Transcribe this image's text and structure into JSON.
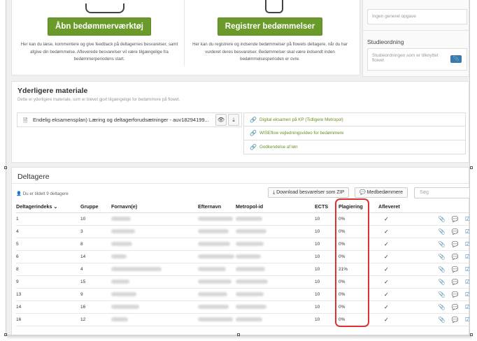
{
  "tools": {
    "left": {
      "button": "Åbn bedømmerværktøj",
      "description": "Her kan du læse, kommentere og give feedback på deltagernes besvarelser, samt afgive din bedømmelse. Afleverede besvarelser vil være tilgængelige fra bedømmerperiodens start."
    },
    "right": {
      "button": "Registrer bedømmelser",
      "description": "Her kan du registrere og indsende bedømmelser på flowets deltagere, når du har vurderet deres besvarelser. Bedømmelser skal være indsendt inden bedømmelsesperioden er ovre."
    }
  },
  "sidebar": {
    "general_task_placeholder": "Ingen generel opgave",
    "study_title": "Studieordning",
    "study_placeholder": "Studieordningen som er tilknyttet flowet"
  },
  "material": {
    "title": "Yderligere materiale",
    "subtitle": "Dette er yderligere materiale, som er blevet gjort tilgængelige for bedømmere på flowet.",
    "file": "Endelig eksamensplan) Læring og deltagerforudsætninger - auv18294199...",
    "links": [
      "Digital eksamen på KP (Tidligere Metropol)",
      "WISEflow vejledningsvideo for bedømmere",
      "Godkendelse af løn"
    ]
  },
  "participants": {
    "title": "Deltagere",
    "assigned": "Du er tildelt 9 deltagere",
    "download_label": "Download besvarelser som ZIP",
    "coassessors_label": "Medbedømmere",
    "search_placeholder": "Søg",
    "columns": [
      "Deltagerindeks",
      "Gruppe",
      "Fornavn(e)",
      "Efternavn",
      "Metropol-id",
      "ECTS",
      "Plagiering",
      "Afleveret"
    ],
    "rows": [
      {
        "index": "1",
        "group": "10",
        "ects": "10",
        "plag": "0%",
        "delivered": "✓"
      },
      {
        "index": "4",
        "group": "3",
        "ects": "10",
        "plag": "0%",
        "delivered": "✓"
      },
      {
        "index": "5",
        "group": "8",
        "ects": "10",
        "plag": "0%",
        "delivered": "✓"
      },
      {
        "index": "6",
        "group": "14",
        "ects": "10",
        "plag": "0%",
        "delivered": "✓"
      },
      {
        "index": "8",
        "group": "4",
        "ects": "10",
        "plag": "21%",
        "delivered": "✓"
      },
      {
        "index": "9",
        "group": "15",
        "ects": "10",
        "plag": "0%",
        "delivered": "✓"
      },
      {
        "index": "13",
        "group": "9",
        "ects": "10",
        "plag": "0%",
        "delivered": "✓"
      },
      {
        "index": "14",
        "group": "16",
        "ects": "10",
        "plag": "0%",
        "delivered": "✓"
      },
      {
        "index": "16",
        "group": "12",
        "ects": "10",
        "plag": "0%",
        "delivered": "✓"
      }
    ]
  },
  "colors": {
    "accent_green": "#6a9a2a",
    "link_green": "#6a8f2a",
    "highlight_red": "#d93333",
    "attach_blue": "#3a7ab0"
  }
}
